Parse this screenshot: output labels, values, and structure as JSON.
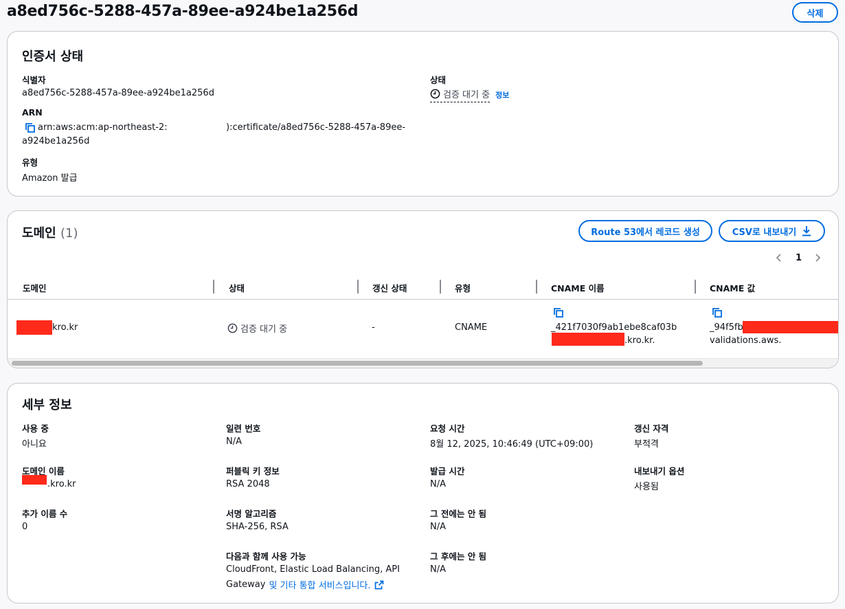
{
  "page": {
    "title": "a8ed756c-5288-457a-89ee-a924be1a256d",
    "delete_label": "삭제"
  },
  "cert_status": {
    "heading": "인증서 상태",
    "identifier_label": "식별자",
    "identifier_value": "a8ed756c-5288-457a-89ee-a924be1a256d",
    "arn_label": "ARN",
    "arn_line1_left": "arn:aws:acm:ap-northeast-2:",
    "arn_line1_right": "):certificate/a8ed756c-5288-457a-89ee-",
    "arn_line2": "a924be1a256d",
    "type_label": "유형",
    "type_value": "Amazon 발급",
    "status_label": "상태",
    "status_value": "검증 대기 중",
    "info_link": "정보"
  },
  "domains": {
    "heading": "도메인",
    "count": "(1)",
    "route53_button": "Route 53에서 레코드 생성",
    "csv_button": "CSV로 내보내기",
    "page_number": "1",
    "columns": [
      "도메인",
      "상태",
      "갱신 상태",
      "유형",
      "CNAME 이름",
      "CNAME 값"
    ],
    "row": {
      "domain_suffix": "kro.kr",
      "status": "검증 대기 중",
      "renewal_status": "-",
      "type": "CNAME",
      "cname_name_line1": "_421f7030f9ab1ebe8caf03b",
      "cname_name_line2_suffix": ".kro.kr.",
      "cname_value_line1_prefix": "_94f5fb",
      "cname_value_line2": "validations.aws."
    }
  },
  "details": {
    "heading": "세부 정보",
    "in_use_label": "사용 중",
    "in_use_value": "아니요",
    "domain_name_label": "도메인 이름",
    "domain_name_suffix": ".kro.kr",
    "additional_names_label": "추가 이름 수",
    "additional_names_value": "0",
    "serial_label": "일련 번호",
    "serial_value": "N/A",
    "public_key_label": "퍼블릭 키 정보",
    "public_key_value": "RSA 2048",
    "signature_label": "서명 알고리즘",
    "signature_value": "SHA-256, RSA",
    "can_be_used_label": "다음과 함께 사용 가능",
    "can_be_used_line1": "CloudFront, Elastic Load Balancing, API",
    "can_be_used_line2_prefix": "Gateway",
    "can_be_used_link": "및 기타 통합 서비스입니다.",
    "requested_label": "요청 시간",
    "requested_value": "8월 12, 2025, 10:46:49 (UTC+09:00)",
    "issued_label": "발급 시간",
    "issued_value": "N/A",
    "not_before_label": "그 전에는 안 됨",
    "not_before_value": "N/A",
    "not_after_label": "그 후에는 안 됨",
    "not_after_value": "N/A",
    "renewal_eligibility_label": "갱신 자격",
    "renewal_eligibility_value": "부적격",
    "export_option_label": "내보내기 옵션",
    "export_option_value": "사용됨"
  },
  "colors": {
    "accent": "#006ce0",
    "redaction": "#ff2a1a",
    "border": "#c6c6cd"
  },
  "icons": [
    "copy-icon",
    "clock-icon",
    "download-icon",
    "external-link-icon",
    "chevron-left-icon",
    "chevron-right-icon"
  ]
}
